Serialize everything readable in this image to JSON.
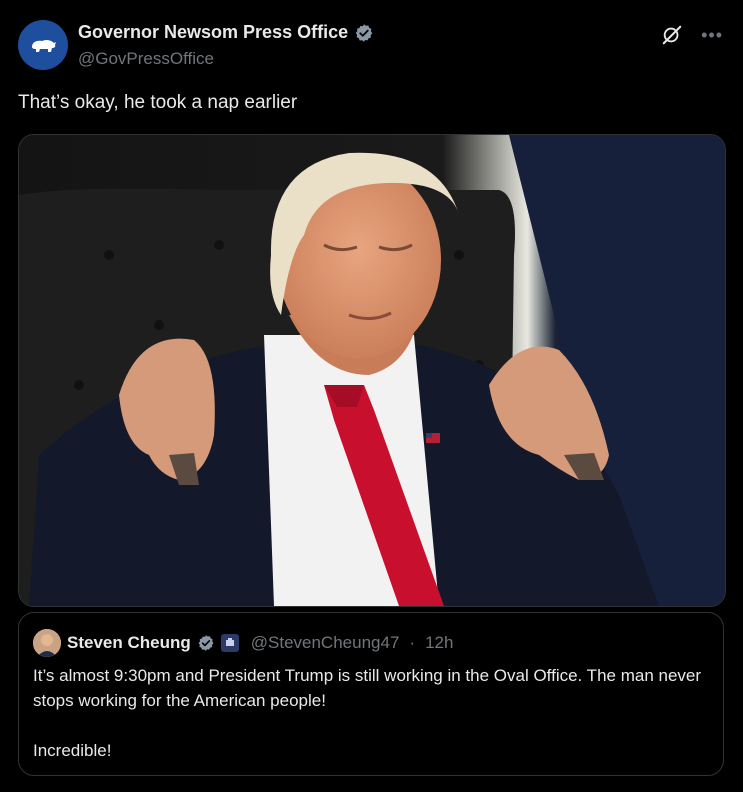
{
  "tweet": {
    "author_name": "Governor Newsom Press Office",
    "author_handle": "@GovPressOffice",
    "text": "That’s okay, he took a nap earlier"
  },
  "media": {
    "icon": "photo"
  },
  "quote": {
    "author_name": "Steven Cheung",
    "author_handle": "@StevenCheung47",
    "separator": "·",
    "time": "12h",
    "paragraphs": [
      "It’s almost 9:30pm and President Trump is still working in the Oval Office. The man never stops working for the American people!",
      "Incredible!"
    ]
  },
  "colors": {
    "background": "#000000",
    "text_primary": "#e7e9ea",
    "text_secondary": "#71767b",
    "verified_gray": "#8b98a5",
    "border": "#2f3336"
  }
}
